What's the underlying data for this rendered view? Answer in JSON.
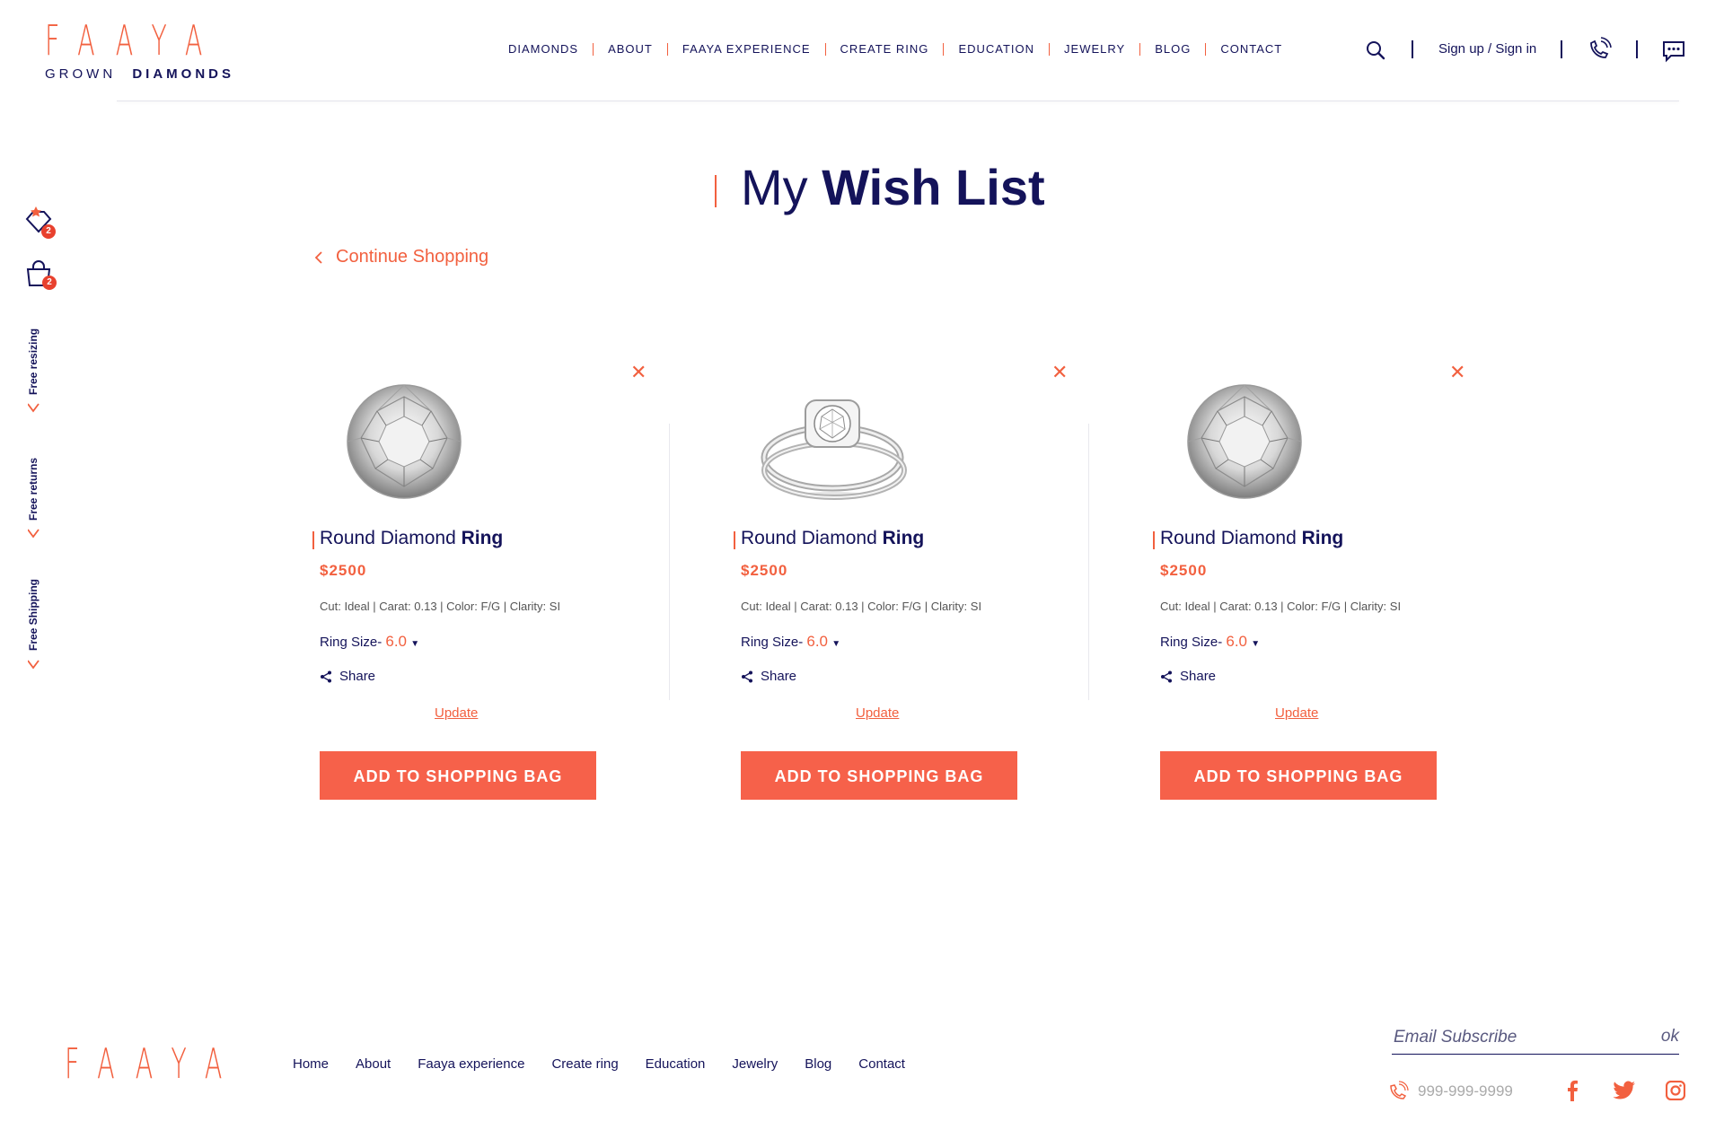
{
  "header": {
    "logo": {
      "letters": "FAAYA",
      "sub_light": "GROWN",
      "sub_bold": "DIAMONDS"
    },
    "nav": [
      "DIAMONDS",
      "ABOUT",
      "FAAYA EXPERIENCE",
      "CREATE RING",
      "EDUCATION",
      "JEWELRY",
      "BLOG",
      "CONTACT"
    ],
    "signin": "Sign up / Sign in",
    "icons": [
      "search-icon",
      "phone-icon",
      "chat-icon"
    ]
  },
  "rail": {
    "wishlist_count": "2",
    "bag_count": "2",
    "perks": [
      "Free resizing",
      "Free returns",
      "Free Shipping"
    ]
  },
  "page": {
    "title_light": "My",
    "title_bold": "Wish List",
    "continue": "Continue Shopping"
  },
  "items": [
    {
      "name_light": "Round Diamond",
      "name_bold": "Ring",
      "price": "$2500",
      "specs": "Cut: Ideal | Carat: 0.13 | Color: F/G | Clarity: SI",
      "size_label": "Ring Size-",
      "size_value": "6.0",
      "share": "Share",
      "update": "Update",
      "button": "ADD TO SHOPPING BAG",
      "image": "diamond"
    },
    {
      "name_light": "Round Diamond",
      "name_bold": "Ring",
      "price": "$2500",
      "specs": "Cut: Ideal | Carat: 0.13 | Color: F/G | Clarity: SI",
      "size_label": "Ring Size-",
      "size_value": "6.0",
      "share": "Share",
      "update": "Update",
      "button": "ADD TO SHOPPING BAG",
      "image": "ring"
    },
    {
      "name_light": "Round Diamond",
      "name_bold": "Ring",
      "price": "$2500",
      "specs": "Cut: Ideal | Carat: 0.13 | Color: F/G | Clarity: SI",
      "size_label": "Ring Size-",
      "size_value": "6.0",
      "share": "Share",
      "update": "Update",
      "button": "ADD TO SHOPPING BAG",
      "image": "diamond"
    }
  ],
  "footer": {
    "logo": "FAAYA",
    "nav": [
      "Home",
      "About",
      "Faaya experience",
      "Create ring",
      "Education",
      "Jewelry",
      "Blog",
      "Contact"
    ],
    "email_placeholder": "Email Subscribe",
    "ok": "ok",
    "phone": "999-999-9999",
    "social": [
      "facebook-icon",
      "twitter-icon",
      "instagram-icon"
    ]
  },
  "colors": {
    "accent": "#f2603f",
    "navy": "#14135a",
    "button": "#f6614a"
  }
}
